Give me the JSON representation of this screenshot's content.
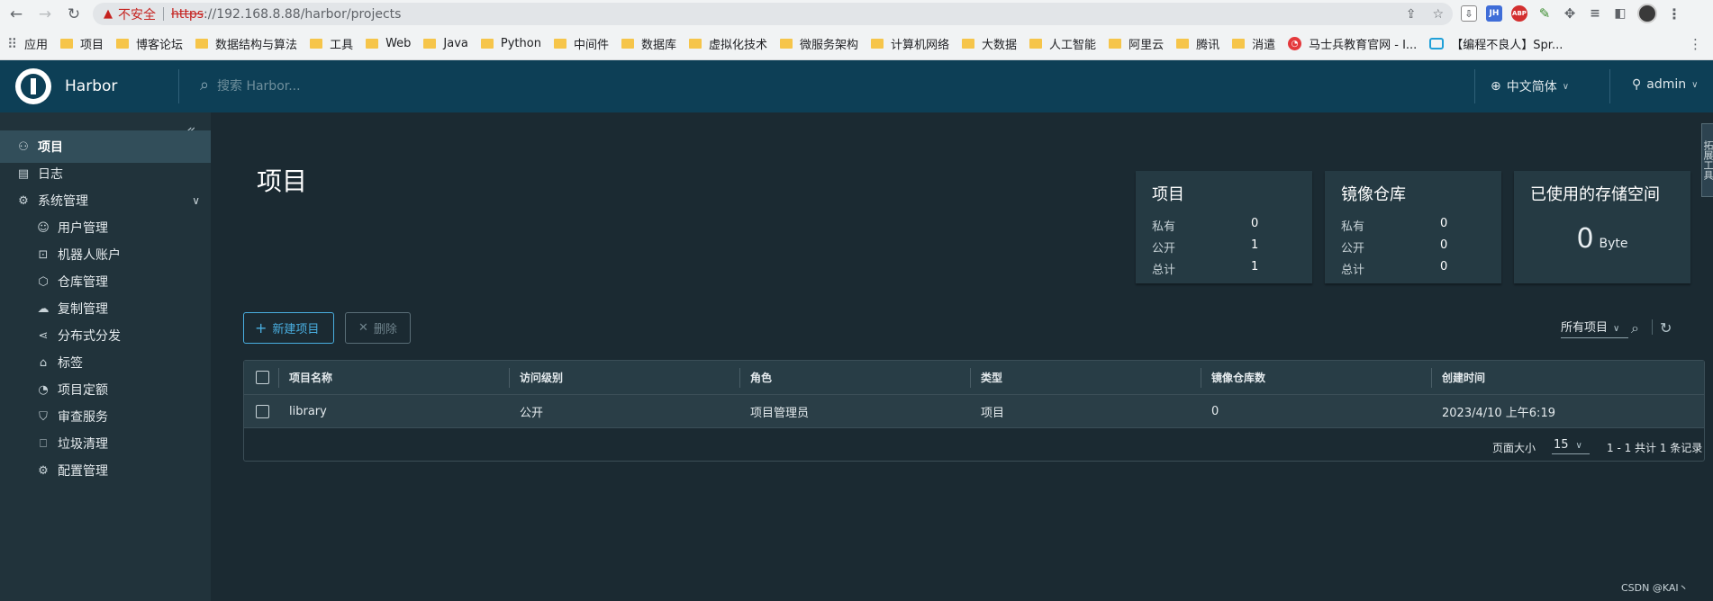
{
  "browser": {
    "insecure_label": "不安全",
    "url_scheme": "https",
    "url_rest": "://192.168.8.88/harbor/projects",
    "ext_jh": "JH",
    "ext_abp": "ABP",
    "bookmarks": [
      {
        "label": "应用",
        "kind": "apps"
      },
      {
        "label": "项目",
        "kind": "folder"
      },
      {
        "label": "博客论坛",
        "kind": "folder"
      },
      {
        "label": "数据结构与算法",
        "kind": "folder"
      },
      {
        "label": "工具",
        "kind": "folder"
      },
      {
        "label": "Web",
        "kind": "folder"
      },
      {
        "label": "Java",
        "kind": "folder"
      },
      {
        "label": "Python",
        "kind": "folder"
      },
      {
        "label": "中间件",
        "kind": "folder"
      },
      {
        "label": "数据库",
        "kind": "folder"
      },
      {
        "label": "虚拟化技术",
        "kind": "folder"
      },
      {
        "label": "微服务架构",
        "kind": "folder"
      },
      {
        "label": "计算机网络",
        "kind": "folder"
      },
      {
        "label": "大数据",
        "kind": "folder"
      },
      {
        "label": "人工智能",
        "kind": "folder"
      },
      {
        "label": "阿里云",
        "kind": "folder"
      },
      {
        "label": "腾讯",
        "kind": "folder"
      },
      {
        "label": "消遣",
        "kind": "folder"
      },
      {
        "label": "马士兵教育官网 - I...",
        "kind": "site-red"
      },
      {
        "label": "【编程不良人】Spr...",
        "kind": "site-tv"
      }
    ]
  },
  "header": {
    "brand": "Harbor",
    "search_placeholder": "搜索 Harbor...",
    "language": "中文简体",
    "user": "admin"
  },
  "sidebar": {
    "items": [
      {
        "label": "项目",
        "icon": "projects-icon",
        "glyph": "⚇",
        "active": true,
        "sub": false
      },
      {
        "label": "日志",
        "icon": "logs-icon",
        "glyph": "▤",
        "active": false,
        "sub": false
      },
      {
        "label": "系统管理",
        "icon": "admin-icon",
        "glyph": "⚙",
        "active": false,
        "sub": false,
        "expandable": true
      },
      {
        "label": "用户管理",
        "icon": "users-icon",
        "glyph": "☺",
        "active": false,
        "sub": true
      },
      {
        "label": "机器人账户",
        "icon": "robot-icon",
        "glyph": "⊡",
        "active": false,
        "sub": true
      },
      {
        "label": "仓库管理",
        "icon": "registry-icon",
        "glyph": "⬡",
        "active": false,
        "sub": true
      },
      {
        "label": "复制管理",
        "icon": "replication-icon",
        "glyph": "☁",
        "active": false,
        "sub": true
      },
      {
        "label": "分布式分发",
        "icon": "distribution-icon",
        "glyph": "⋖",
        "active": false,
        "sub": true
      },
      {
        "label": "标签",
        "icon": "tag-icon",
        "glyph": "⌂",
        "active": false,
        "sub": true
      },
      {
        "label": "项目定额",
        "icon": "quota-icon",
        "glyph": "◔",
        "active": false,
        "sub": true
      },
      {
        "label": "审查服务",
        "icon": "shield-icon",
        "glyph": "⛉",
        "active": false,
        "sub": true
      },
      {
        "label": "垃圾清理",
        "icon": "trash-icon",
        "glyph": "⎕",
        "active": false,
        "sub": true
      },
      {
        "label": "配置管理",
        "icon": "settings-icon",
        "glyph": "⚙",
        "active": false,
        "sub": true
      }
    ]
  },
  "main": {
    "title": "项目",
    "cards": {
      "projects": {
        "title": "项目",
        "rows": [
          {
            "k": "私有",
            "v": "0"
          },
          {
            "k": "公开",
            "v": "1"
          },
          {
            "k": "总计",
            "v": "1"
          }
        ]
      },
      "repos": {
        "title": "镜像仓库",
        "rows": [
          {
            "k": "私有",
            "v": "0"
          },
          {
            "k": "公开",
            "v": "0"
          },
          {
            "k": "总计",
            "v": "0"
          }
        ]
      },
      "storage": {
        "title": "已使用的存储空间",
        "value": "0",
        "unit": "Byte"
      }
    },
    "new_button": "新建项目",
    "delete_button": "删除",
    "filter": "所有项目",
    "table": {
      "columns": [
        "项目名称",
        "访问级别",
        "角色",
        "类型",
        "镜像仓库数",
        "创建时间"
      ],
      "rows": [
        {
          "name": "library",
          "access": "公开",
          "role": "项目管理员",
          "type": "项目",
          "repos": "0",
          "created": "2023/4/10 上午6:19"
        }
      ],
      "page_size_label": "页面大小",
      "page_size": "15",
      "total": "1 - 1 共计 1 条记录"
    }
  },
  "right_tab": "拓展工具",
  "watermark": "CSDN @KAI丶"
}
